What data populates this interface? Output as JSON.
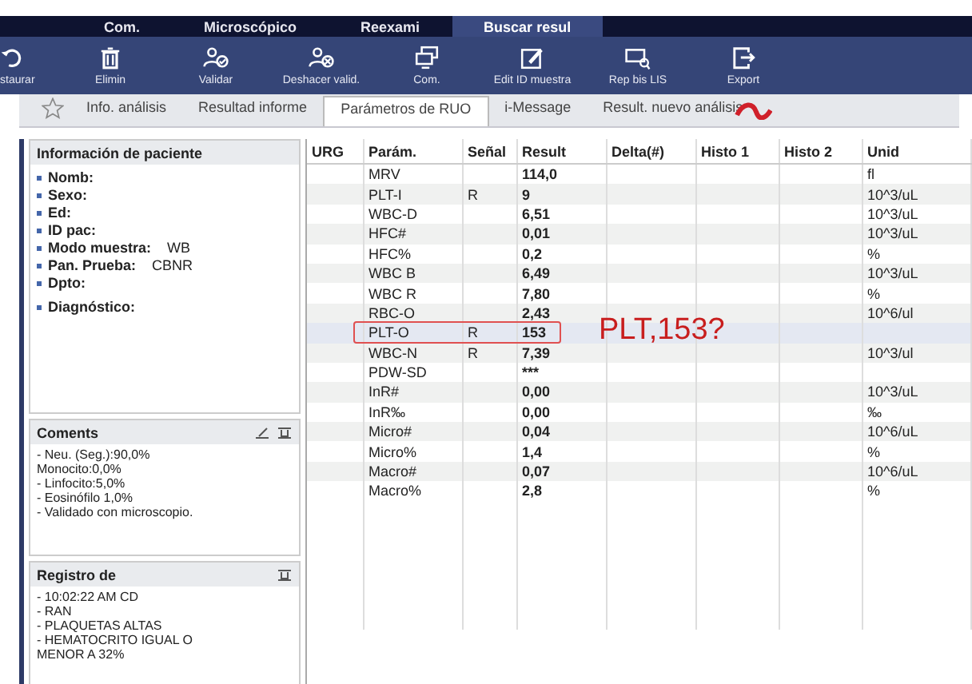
{
  "nav_tabs": [
    {
      "label": "Com.",
      "selected": false
    },
    {
      "label": "Microscópico",
      "selected": false
    },
    {
      "label": "Reexami",
      "selected": false
    },
    {
      "label": "Buscar resul",
      "selected": true
    }
  ],
  "toolbar": [
    {
      "label": "staurar"
    },
    {
      "label": "Elimin"
    },
    {
      "label": "Validar"
    },
    {
      "label": "Deshacer valid."
    },
    {
      "label": "Com."
    },
    {
      "label": "Edit ID muestra"
    },
    {
      "label": "Rep bis LIS"
    },
    {
      "label": "Export"
    }
  ],
  "sub_tabs": [
    {
      "label": "Info. análisis",
      "selected": false
    },
    {
      "label": "Resultad informe",
      "selected": false
    },
    {
      "label": "Parámetros de RUO",
      "selected": true
    },
    {
      "label": "i-Message",
      "selected": false
    },
    {
      "label": "Result. nuevo análisis",
      "selected": false
    }
  ],
  "patient": {
    "title": "Información de paciente",
    "fields": [
      {
        "label": "Nomb:"
      },
      {
        "label": "Sexo:"
      },
      {
        "label": "Ed:"
      },
      {
        "label": "ID pac:"
      },
      {
        "label": "Modo muestra:",
        "value": "WB"
      },
      {
        "label": "Pan. Prueba:",
        "value": "CBNR"
      },
      {
        "label": "Dpto:"
      },
      {
        "label": "Diagnóstico:"
      }
    ]
  },
  "comments": {
    "title": "Coments",
    "lines": [
      "- Neu. (Seg.):90,0%",
      "Monocito:0,0%",
      "- Linfocito:5,0%",
      "- Eosinófilo 1,0%",
      "- Validado con microscopio."
    ]
  },
  "log": {
    "title": "Registro de",
    "lines": [
      "- 10:02:22 AM CD",
      "- RAN",
      "- PLAQUETAS ALTAS",
      "- HEMATOCRITO IGUAL O",
      "MENOR A 32%"
    ]
  },
  "table": {
    "columns": [
      "URG",
      "Parám.",
      "Señal",
      "Result",
      "Delta(#)",
      "Histo 1",
      "Histo 2",
      "Unid"
    ],
    "rows": [
      {
        "param": "MRV",
        "flag": "",
        "result": "114,0",
        "unit": "fl",
        "selected": false
      },
      {
        "param": "PLT-I",
        "flag": "R",
        "result": "9",
        "unit": "10^3/uL",
        "selected": false
      },
      {
        "param": "WBC-D",
        "flag": "",
        "result": "6,51",
        "unit": "10^3/uL",
        "selected": false
      },
      {
        "param": "HFC#",
        "flag": "",
        "result": "0,01",
        "unit": "10^3/uL",
        "selected": false
      },
      {
        "param": "HFC%",
        "flag": "",
        "result": "0,2",
        "unit": "%",
        "selected": false
      },
      {
        "param": "WBC B",
        "flag": "",
        "result": "6,49",
        "unit": "10^3/uL",
        "selected": false
      },
      {
        "param": "WBC R",
        "flag": "",
        "result": "7,80",
        "unit": "%",
        "selected": false
      },
      {
        "param": "RBC-O",
        "flag": "",
        "result": "2,43",
        "unit": "10^6/ul",
        "selected": false
      },
      {
        "param": "PLT-O",
        "flag": "R",
        "result": "153",
        "unit": "",
        "selected": true
      },
      {
        "param": "WBC-N",
        "flag": "R",
        "result": "7,39",
        "unit": "10^3/ul",
        "selected": false
      },
      {
        "param": "PDW-SD",
        "flag": "",
        "result": "***",
        "unit": "",
        "selected": false
      },
      {
        "param": "InR#",
        "flag": "",
        "result": "0,00",
        "unit": "10^3/uL",
        "selected": false
      },
      {
        "param": "InR‰",
        "flag": "",
        "result": "0,00",
        "unit": "‰",
        "selected": false
      },
      {
        "param": "Micro#",
        "flag": "",
        "result": "0,04",
        "unit": "10^6/uL",
        "selected": false
      },
      {
        "param": "Micro%",
        "flag": "",
        "result": "1,4",
        "unit": "%",
        "selected": false
      },
      {
        "param": "Macro#",
        "flag": "",
        "result": "0,07",
        "unit": "10^6/uL",
        "selected": false
      },
      {
        "param": "Macro%",
        "flag": "",
        "result": "2,8",
        "unit": "%",
        "selected": false
      }
    ]
  },
  "annotation": {
    "text": "PLT,153?"
  }
}
